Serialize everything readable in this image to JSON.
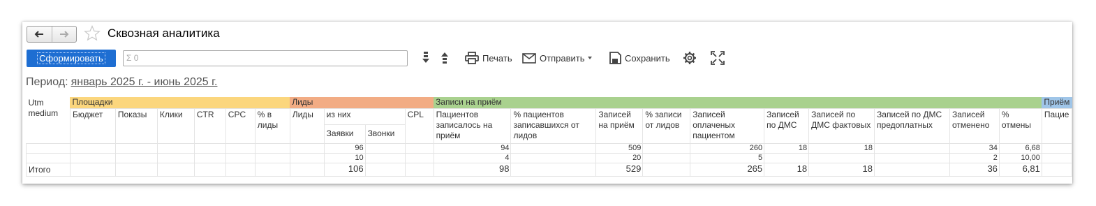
{
  "window": {
    "title": "Сквозная аналитика"
  },
  "toolbar": {
    "generate_label": "Сформировать",
    "search_placeholder": "Σ 0",
    "print_label": "Печать",
    "send_label": "Отправить",
    "save_label": "Сохранить"
  },
  "period": {
    "label": "Период:",
    "value": "январь 2025 г. - июнь 2025 г."
  },
  "table": {
    "utm_header": "Utm medium",
    "groups": {
      "ploshchadki": "Площадки",
      "lidy": "Лиды",
      "zapisi": "Записи на приём",
      "priem": "Приём"
    },
    "columns": {
      "budget": "Бюджет",
      "shows": "Показы",
      "clicks": "Клики",
      "ctr": "CTR",
      "cpc": "CPC",
      "pct_leads": "% в лиды",
      "leads": "Лиды",
      "of_them": "из них",
      "requests": "Заявки",
      "calls": "Звонки",
      "cpl": "CPL",
      "patients_recorded": "Пациентов записалось на приём",
      "pct_patients_from_leads": "% пациентов записавшихся от лидов",
      "records": "Записей на приём",
      "pct_records_from_leads": "% записи от лидов",
      "paid_by_patient": "Записей оплаченых пациентом",
      "dms": "Записей по ДМС",
      "dms_fact": "Записей по ДМС фактовых",
      "dms_prepaid": "Записей по ДМС предоплатных",
      "cancelled": "Записей отменено",
      "pct_cancel": "% отмены",
      "patients_cut": "Пацие"
    },
    "rows": [
      {
        "utm": "",
        "requests": "96",
        "patients": "94",
        "records": "509",
        "paid": "260",
        "dms": "18",
        "dms_fact": "18",
        "cancelled": "34",
        "pct_cancel": "6,68"
      },
      {
        "utm": "",
        "requests": "10",
        "patients": "4",
        "records": "20",
        "paid": "5",
        "dms": "",
        "dms_fact": "",
        "cancelled": "2",
        "pct_cancel": "10,00"
      }
    ],
    "total": {
      "label": "Итого",
      "requests": "106",
      "patients": "98",
      "records": "529",
      "paid": "265",
      "dms": "18",
      "dms_fact": "18",
      "cancelled": "36",
      "pct_cancel": "6,81"
    }
  }
}
